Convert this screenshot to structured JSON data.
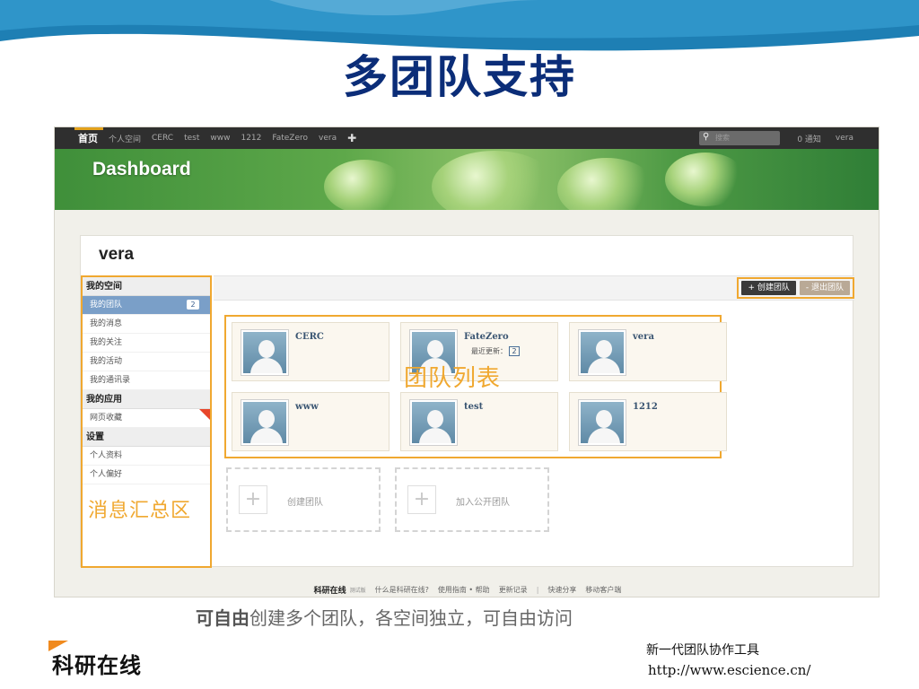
{
  "slide": {
    "title": "多团队支持",
    "caption_emphasis": "可自由",
    "caption_rest": "创建多个团队，各空间独立，可自由访问",
    "logo_text": "科研在线",
    "tagline": "新一代团队协作工具",
    "url": "http://www.escience.cn/"
  },
  "nav": {
    "items": [
      "首页",
      "个人空间",
      "CERC",
      "test",
      "www",
      "1212",
      "FateZero",
      "vera"
    ],
    "add_icon": "plus-icon",
    "search_placeholder": "搜索",
    "notifications": "0 通知",
    "user": "vera"
  },
  "banner": {
    "title": "Dashboard"
  },
  "profile": {
    "name": "vera"
  },
  "sidebar": {
    "sections": [
      {
        "heading": "我的空间",
        "items": [
          {
            "label": "我的团队",
            "badge": "2",
            "active": true
          },
          {
            "label": "我的消息"
          },
          {
            "label": "我的关注"
          },
          {
            "label": "我的活动"
          },
          {
            "label": "我的通讯录"
          }
        ]
      },
      {
        "heading": "我的应用",
        "items": [
          {
            "label": "网页收藏"
          }
        ]
      },
      {
        "heading": "设置",
        "items": [
          {
            "label": "个人资料"
          },
          {
            "label": "个人偏好"
          }
        ]
      }
    ],
    "annotation": "消息汇总区"
  },
  "toolbar": {
    "create_team": "+ 创建团队",
    "leave_team": "- 退出团队"
  },
  "teams": [
    {
      "name": "CERC"
    },
    {
      "name": "FateZero",
      "meta_label": "最近更新：",
      "meta_count": "2"
    },
    {
      "name": "vera"
    },
    {
      "name": "www"
    },
    {
      "name": "test"
    },
    {
      "name": "1212"
    }
  ],
  "team_list_annotation": "团队列表",
  "actions": {
    "create": "创建团队",
    "join": "加入公开团队"
  },
  "footer": {
    "brand": "科研在线",
    "beta": "测试版",
    "links": [
      "什么是科研在线?",
      "使用指南 • 帮助",
      "更新记录",
      "快速分享",
      "移动客户端"
    ]
  },
  "colors": {
    "title_blue": "#0b2d78",
    "highlight_orange": "#f0a830",
    "nav_bg": "#2f2f2f",
    "active_blue": "#7a9fc8"
  }
}
